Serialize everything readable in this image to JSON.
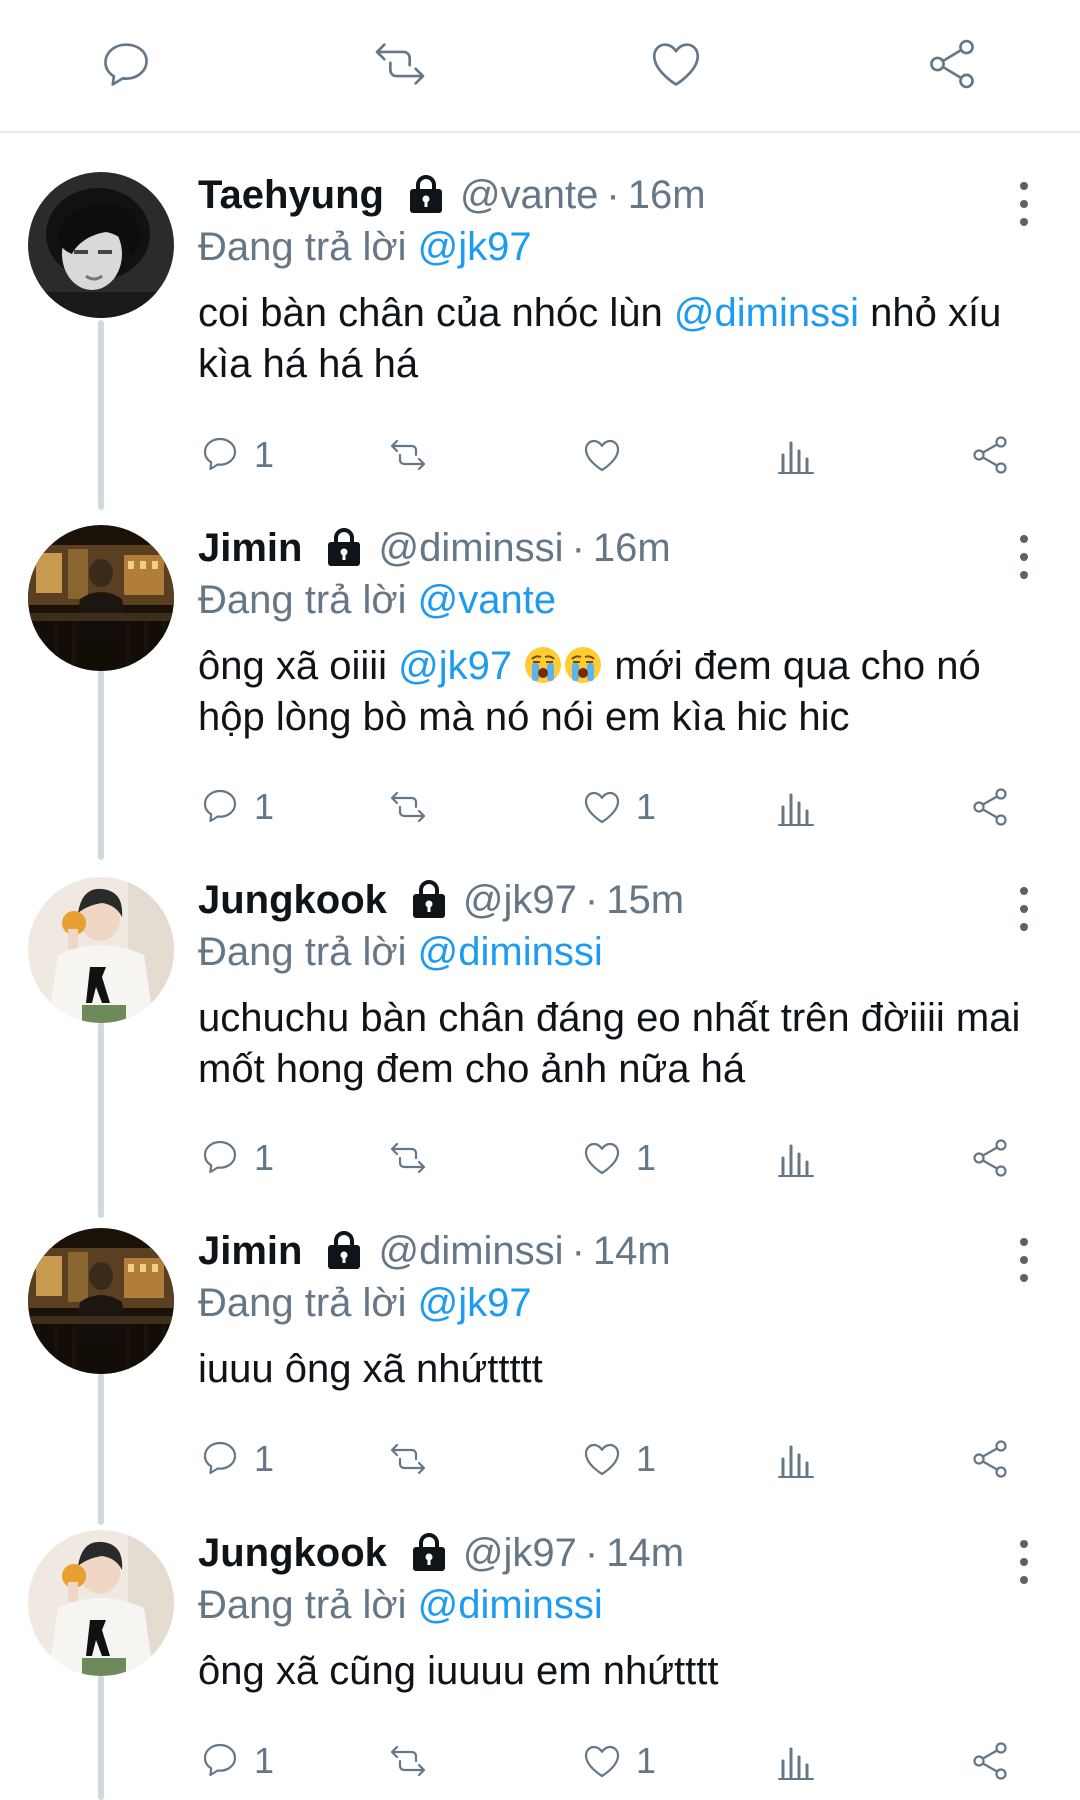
{
  "top_actions": [
    {
      "name": "reply-icon"
    },
    {
      "name": "retweet-icon"
    },
    {
      "name": "like-icon"
    },
    {
      "name": "share-icon"
    }
  ],
  "tweets": [
    {
      "name": "Taehyung",
      "handle": "@vante",
      "dot": "·",
      "time": "16m",
      "reply_prefix": "Đang trả lời",
      "reply_to": "@jk97",
      "body": [
        {
          "t": "text",
          "v": "coi bàn chân của nhóc lùn "
        },
        {
          "t": "mention",
          "v": "@diminssi"
        },
        {
          "t": "text",
          "v": " nhỏ xíu kìa há há há"
        }
      ],
      "replies": "1",
      "retweets": "",
      "likes": "",
      "avatar": "dark"
    },
    {
      "name": "Jimin",
      "handle": "@diminssi",
      "dot": "·",
      "time": "16m",
      "reply_prefix": "Đang trả lời",
      "reply_to": "@vante",
      "body": [
        {
          "t": "text",
          "v": "ông xã oiiii "
        },
        {
          "t": "mention",
          "v": "@jk97"
        },
        {
          "t": "text",
          "v": " "
        },
        {
          "t": "emoji",
          "v": "crying-face"
        },
        {
          "t": "emoji",
          "v": "crying-face"
        },
        {
          "t": "text",
          "v": " mới đem qua cho nó hộp lòng bò mà nó nói em kìa hic hic"
        }
      ],
      "replies": "1",
      "retweets": "",
      "likes": "1",
      "avatar": "night"
    },
    {
      "name": "Jungkook",
      "handle": "@jk97",
      "dot": "·",
      "time": "15m",
      "reply_prefix": "Đang trả lời",
      "reply_to": "@diminssi",
      "body": [
        {
          "t": "text",
          "v": "uchuchu bàn chân đáng eo nhất trên đờiiii mai mốt hong đem cho ảnh nữa há"
        }
      ],
      "replies": "1",
      "retweets": "",
      "likes": "1",
      "avatar": "light"
    },
    {
      "name": "Jimin",
      "handle": "@diminssi",
      "dot": "·",
      "time": "14m",
      "reply_prefix": "Đang trả lời",
      "reply_to": "@jk97",
      "body": [
        {
          "t": "text",
          "v": "iuuu ông xã nhứttttt"
        }
      ],
      "replies": "1",
      "retweets": "",
      "likes": "1",
      "avatar": "night"
    },
    {
      "name": "Jungkook",
      "handle": "@jk97",
      "dot": "·",
      "time": "14m",
      "reply_prefix": "Đang trả lời",
      "reply_to": "@diminssi",
      "body": [
        {
          "t": "text",
          "v": "ông xã cũng iuuuu em nhứtttt"
        }
      ],
      "replies": "1",
      "retweets": "",
      "likes": "1",
      "avatar": "light"
    }
  ],
  "colors": {
    "mention": "#1d9bf0",
    "muted": "#657786",
    "text": "#0f1419",
    "divider": "#e6ecf0"
  }
}
